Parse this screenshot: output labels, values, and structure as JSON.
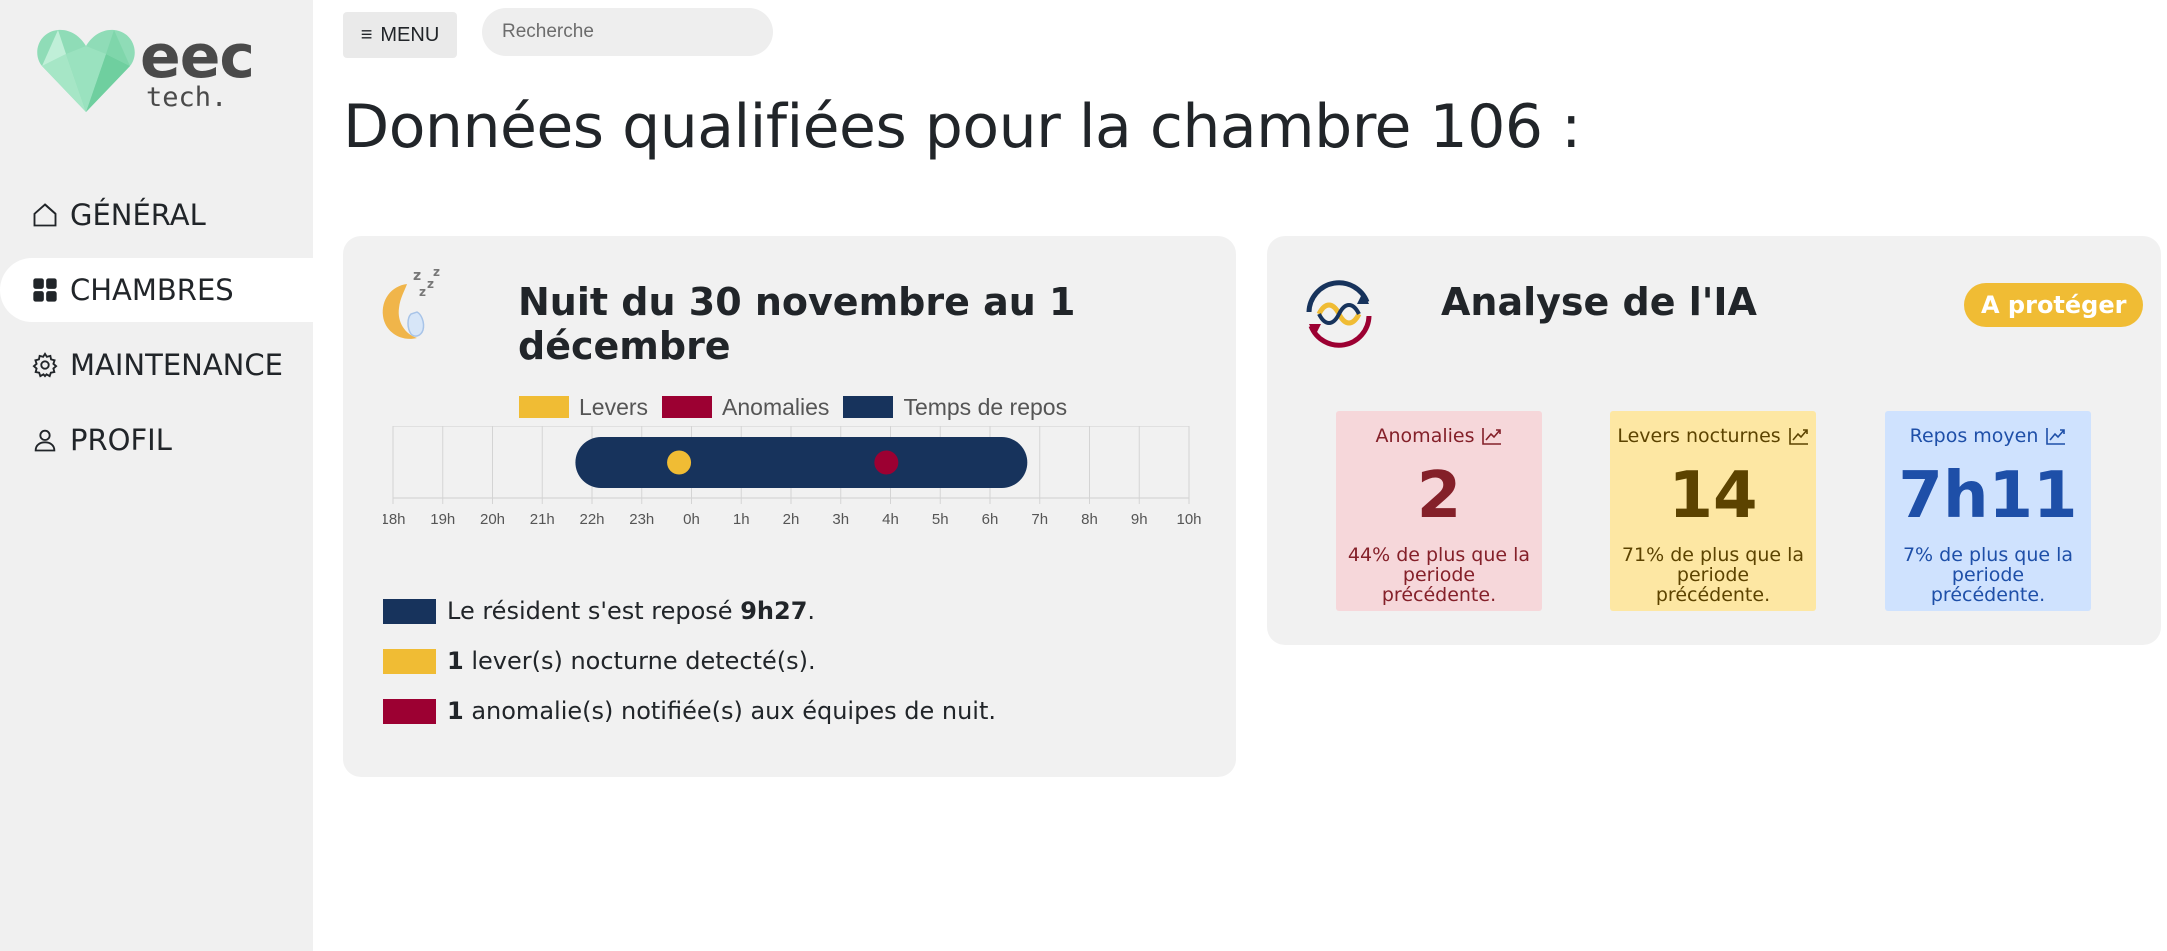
{
  "brand": {
    "name": "eec",
    "sub": "tech."
  },
  "nav": {
    "items": [
      {
        "label": "GÉNÉRAL"
      },
      {
        "label": "CHAMBRES"
      },
      {
        "label": "MAINTENANCE"
      },
      {
        "label": "PROFIL"
      }
    ]
  },
  "topbar": {
    "menu_label": "MENU",
    "search_placeholder": "Recherche"
  },
  "page_title": "Données qualifiées pour la chambre 106 :",
  "night_card": {
    "title": "Nuit du 30 novembre au 1 décembre",
    "legend": [
      "Levers",
      "Anomalies",
      "Temps de repos"
    ],
    "stats": {
      "rest_prefix": "Le résident s'est reposé ",
      "rest_value": "9h27",
      "rest_suffix": ".",
      "levers_count": "1",
      "levers_text": " lever(s) nocturne detecté(s).",
      "anomalies_count": "1",
      "anomalies_text": " anomalie(s) notifiée(s) aux équipes de nuit."
    }
  },
  "chart_data": {
    "type": "timeline",
    "categories": [
      "18h",
      "19h",
      "20h",
      "21h",
      "22h",
      "23h",
      "0h",
      "1h",
      "2h",
      "3h",
      "4h",
      "5h",
      "6h",
      "7h",
      "8h",
      "9h",
      "10h"
    ],
    "series": [
      {
        "name": "Temps de repos",
        "start": "21h40",
        "end": "6h45",
        "color": "#17335c"
      },
      {
        "name": "Levers",
        "points": [
          "23h45"
        ],
        "color": "#f0bc34"
      },
      {
        "name": "Anomalies",
        "points": [
          "3h55"
        ],
        "color": "#9c0032"
      }
    ],
    "grid": true,
    "legend": "top"
  },
  "ia_card": {
    "title": "Analyse de l'IA",
    "badge": "A protéger",
    "tiles": [
      {
        "label": "Anomalies",
        "value": "2",
        "note_line1": "44% de plus que la",
        "note_line2": "periode précédente."
      },
      {
        "label": "Levers nocturnes",
        "value": "14",
        "note_line1": "71% de plus que la",
        "note_line2": "periode précédente."
      },
      {
        "label": "Repos moyen",
        "value": "7h11",
        "note_line1": "7% de plus que la",
        "note_line2": "periode précédente."
      }
    ]
  },
  "colors": {
    "levers": "#f0bc34",
    "anomalies": "#9c0032",
    "repos": "#17335c",
    "tile_red_bg": "#f6d7da",
    "tile_red_fg": "#842029",
    "tile_yellow_bg": "#fde7a3",
    "tile_yellow_fg": "#5c4300",
    "tile_blue_bg": "#cfe2fe",
    "tile_blue_fg": "#1e4fa8"
  }
}
